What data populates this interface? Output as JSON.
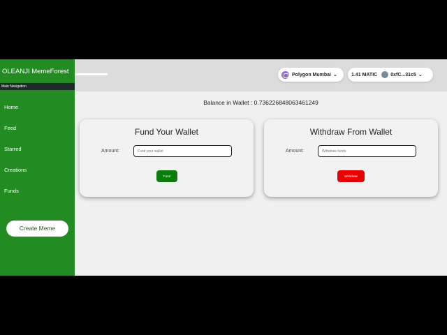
{
  "sidebar": {
    "brand": "OLEANJI MemeForest",
    "section_label": "Main Navigation",
    "items": [
      {
        "label": "Home"
      },
      {
        "label": "Feed"
      },
      {
        "label": "Starred"
      },
      {
        "label": "Creations"
      },
      {
        "label": "Funds"
      }
    ],
    "create_button": "Create Meme"
  },
  "header": {
    "network": "Polygon Mumbai",
    "balance_short": "1.41 MATIC",
    "address": "0xfC...31c5",
    "network_icon": "polygon-icon",
    "account_icon": "avatar-icon"
  },
  "main": {
    "balance_text": "Balance in Wallet : 0.736226848063461249",
    "fund_card": {
      "title": "Fund Your Wallet",
      "amount_label": "Amount:",
      "placeholder": "Fund your wallet",
      "button": "Fund"
    },
    "withdraw_card": {
      "title": "Withdraw From Wallet",
      "amount_label": "Amount:",
      "placeholder": "Withdraw funds",
      "button": "Withdraw"
    }
  },
  "colors": {
    "sidebar_bg": "#228b22",
    "fund_button": "#0a7d0a",
    "withdraw_button": "#e60000"
  }
}
